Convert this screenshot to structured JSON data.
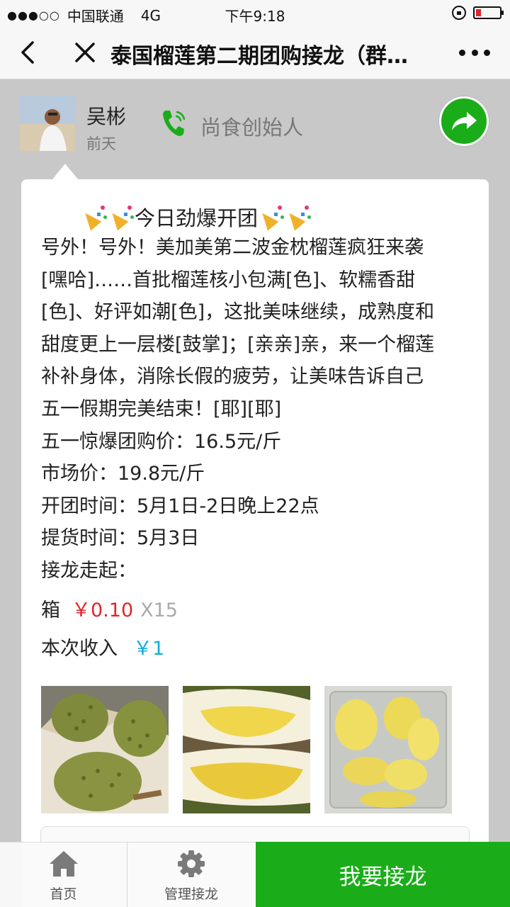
{
  "status_bar": {
    "carrier": "中国联通",
    "network": "4G",
    "time": "下午9:18"
  },
  "navbar": {
    "title": "泰国榴莲第二期团购接龙（群…"
  },
  "author": {
    "name": "吴彬",
    "time": "前天",
    "role": "尚食创始人"
  },
  "post": {
    "headline": "今日劲爆开团",
    "lines": [
      "号外！号外！美加美第二波金枕榴莲疯狂来袭",
      "[嘿哈]……首批榴莲核小包满[色]、软糯香甜",
      "[色]、好评如潮[色]，这批美味继续，成熟度和",
      "甜度更上一层楼[鼓掌]；[亲亲]亲，来一个榴莲",
      "补补身体，消除长假的疲劳，让美味告诉自己",
      "五一假期完美结束！[耶][耶]",
      "五一惊爆团购价：16.5元/斤",
      "市场价：19.8元/斤",
      "开团时间：5月1日-2日晚上22点",
      "提货时间：5月3日",
      "接龙走起："
    ]
  },
  "order": {
    "item": "箱",
    "price": "￥0.10",
    "qty": "X15",
    "income_label": "本次收入",
    "income_amount": "￥1"
  },
  "tabs": {
    "home": "首页",
    "manage": "管理接龙",
    "cta": "我要接龙"
  },
  "colors": {
    "brand_green": "#1aad19",
    "price_red": "#e0242b",
    "income_blue": "#10aeda"
  }
}
